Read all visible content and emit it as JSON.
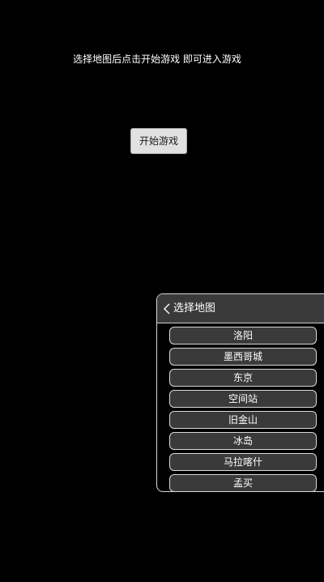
{
  "instruction": "选择地图后点击开始游戏 即可进入游戏",
  "start_button": {
    "label": "开始游戏"
  },
  "map_panel": {
    "back_icon": "chevron-left-icon",
    "title": "选择地图",
    "items": [
      {
        "label": "洛阳"
      },
      {
        "label": "墨西哥城"
      },
      {
        "label": "东京"
      },
      {
        "label": "空间站"
      },
      {
        "label": "旧金山"
      },
      {
        "label": "冰岛"
      },
      {
        "label": "马拉喀什"
      },
      {
        "label": "孟买"
      }
    ]
  },
  "colors": {
    "background": "#000000",
    "panel_fill": "#3a3a3a",
    "panel_border": "#d7d7d7",
    "button_fill": "#e1e1e1",
    "text": "#ffffff"
  }
}
